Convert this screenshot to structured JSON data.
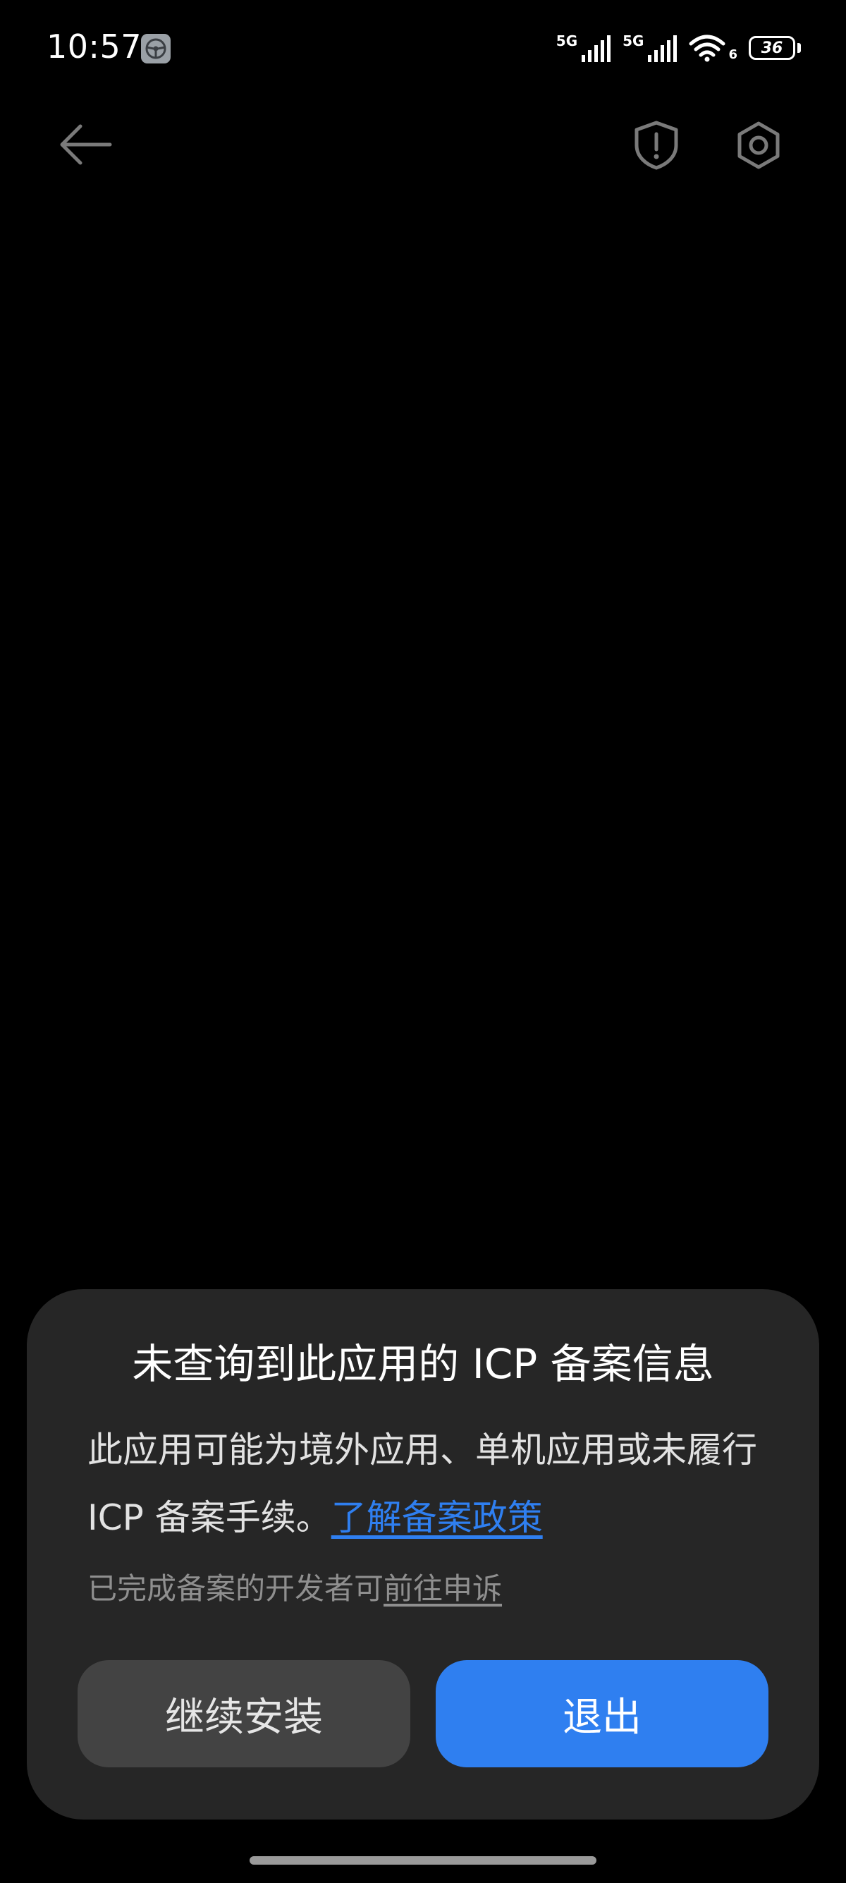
{
  "status_bar": {
    "time": "10:57",
    "notification_icon": "steering-wheel-icon",
    "sim1_label": "5G",
    "sim2_label": "5G",
    "wifi_badge": "6",
    "battery_level": "36"
  },
  "toolbar": {
    "back_icon": "arrow-left-icon",
    "shield_icon": "shield-alert-icon",
    "settings_icon": "gear-icon"
  },
  "dialog": {
    "title": "未查询到此应用的 ICP 备案信息",
    "body_text": "此应用可能为境外应用、单机应用或未履行 ICP 备案手续。",
    "policy_link": "了解备案政策",
    "note_text": "已完成备案的开发者可",
    "appeal_link": "前往申诉",
    "continue_button": "继续安装",
    "exit_button": "退出",
    "colors": {
      "background": "#262626",
      "primary": "#2f7ff0",
      "secondary_button": "#434343"
    }
  }
}
